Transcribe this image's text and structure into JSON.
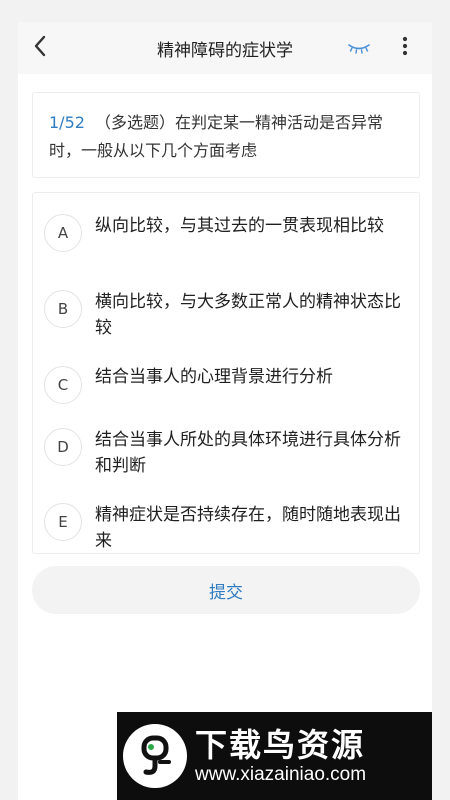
{
  "header": {
    "title": "精神障碍的症状学",
    "back_icon": "chevron-left-icon",
    "eye_icon": "eye-closed-icon",
    "more_icon": "more-vertical-icon",
    "accent_color": "#2f7cc3"
  },
  "question": {
    "number": "1/52",
    "text": "（多选题）在判定某一精神活动是否异常时，一般从以下几个方面考虑"
  },
  "options": [
    {
      "letter": "A",
      "text": "纵向比较，与其过去的一贯表现相比较"
    },
    {
      "letter": "B",
      "text": "横向比较，与大多数正常人的精神状态比较"
    },
    {
      "letter": "C",
      "text": "结合当事人的心理背景进行分析"
    },
    {
      "letter": "D",
      "text": "结合当事人所处的具体环境进行具体分析和判断"
    },
    {
      "letter": "E",
      "text": "精神症状是否持续存在，随时随地表现出来"
    }
  ],
  "submit_label": "提交",
  "watermark": {
    "title": "下载鸟资源",
    "url": "www.xiazainiao.com"
  }
}
